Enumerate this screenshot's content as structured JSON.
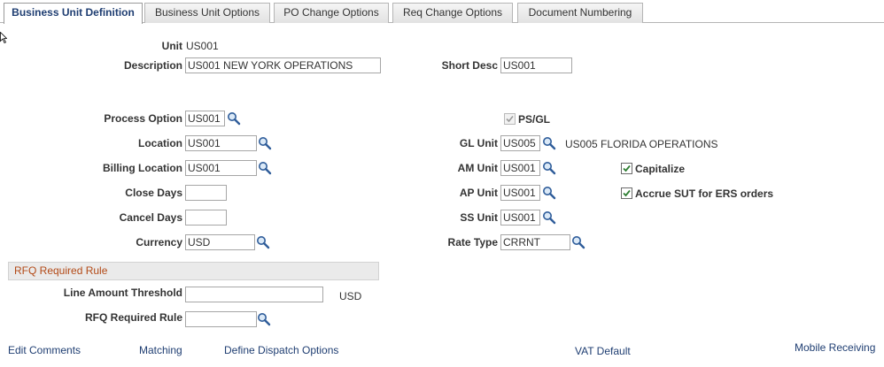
{
  "tabs": [
    {
      "label": "Business Unit Definition",
      "active": true
    },
    {
      "label": "Business Unit Options",
      "active": false
    },
    {
      "label": "PO Change Options",
      "active": false
    },
    {
      "label": "Req Change Options",
      "active": false
    },
    {
      "label": "Document Numbering",
      "active": false
    }
  ],
  "form": {
    "unit_label": "Unit",
    "unit_value": "US001",
    "description_label": "Description",
    "description_value": "US001 NEW YORK OPERATIONS",
    "short_desc_label": "Short Desc",
    "short_desc_value": "US001",
    "process_option_label": "Process Option",
    "process_option_value": "US001",
    "psgl_label": "PS/GL",
    "psgl_checked": true,
    "location_label": "Location",
    "location_value": "US001",
    "gl_unit_label": "GL Unit",
    "gl_unit_value": "US005",
    "gl_unit_desc": "US005 FLORIDA OPERATIONS",
    "billing_location_label": "Billing Location",
    "billing_location_value": "US001",
    "am_unit_label": "AM Unit",
    "am_unit_value": "US001",
    "capitalize_label": "Capitalize",
    "capitalize_checked": true,
    "close_days_label": "Close Days",
    "close_days_value": "",
    "ap_unit_label": "AP Unit",
    "ap_unit_value": "US001",
    "accrue_label": "Accrue SUT for ERS orders",
    "accrue_checked": true,
    "cancel_days_label": "Cancel Days",
    "cancel_days_value": "",
    "ss_unit_label": "SS Unit",
    "ss_unit_value": "US001",
    "currency_label": "Currency",
    "currency_value": "USD",
    "rate_type_label": "Rate Type",
    "rate_type_value": "CRRNT"
  },
  "rfq": {
    "section_title": "RFQ Required Rule",
    "line_amount_label": "Line Amount Threshold",
    "line_amount_value": "",
    "line_amount_currency": "USD",
    "rule_label": "RFQ Required Rule",
    "rule_value": ""
  },
  "links": {
    "edit_comments": "Edit Comments",
    "matching": "Matching",
    "define_dispatch": "Define Dispatch Options",
    "vat_default": "VAT Default",
    "mobile_receiving": "Mobile Receiving"
  },
  "colors": {
    "link": "#1f3e72",
    "section_title": "#b34a17",
    "checkmark": "#2e7d32"
  },
  "icons": {
    "lookup": "magnifier-icon",
    "cursor": "mouse-pointer-icon"
  }
}
